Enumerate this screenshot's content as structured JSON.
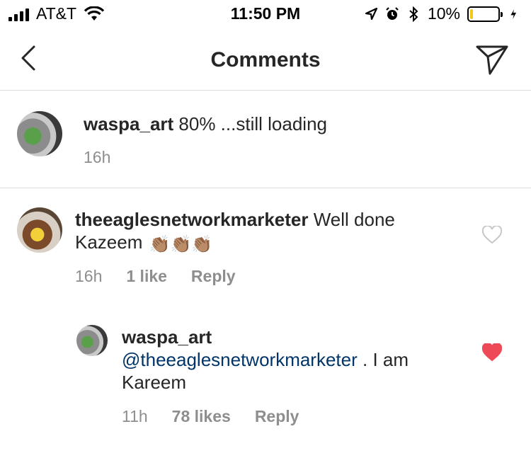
{
  "status_bar": {
    "carrier": "AT&T",
    "time": "11:50 PM",
    "battery_percent": "10%",
    "battery_level": 0.1,
    "icons": [
      "signal-icon",
      "wifi-icon",
      "location-icon",
      "alarm-icon",
      "bluetooth-icon",
      "battery-icon",
      "charging-icon"
    ]
  },
  "nav": {
    "title": "Comments",
    "back_icon": "chevron-left-icon",
    "share_icon": "direct-send-icon"
  },
  "caption": {
    "username": "waspa_art",
    "text": "80% ...still loading",
    "time": "16h"
  },
  "comments": [
    {
      "username": "theeaglesnetworkmarketer",
      "text": "Well done Kazeem",
      "emoji": "👏🏽👏🏽👏🏽",
      "time": "16h",
      "likes": "1 like",
      "reply": "Reply",
      "liked": false,
      "heart_color": "#c7c7c7"
    },
    {
      "username": "waspa_art",
      "mention": "@theeaglesnetworkmarketer",
      "text": ". I am Kareem",
      "time": "11h",
      "likes": "78 likes",
      "reply": "Reply",
      "liked": true,
      "heart_color": "#ed4956"
    }
  ],
  "colors": {
    "mention": "#003569",
    "meta": "#8e8e8e",
    "divider": "#dbdbdb",
    "battery": "#f5c518"
  }
}
